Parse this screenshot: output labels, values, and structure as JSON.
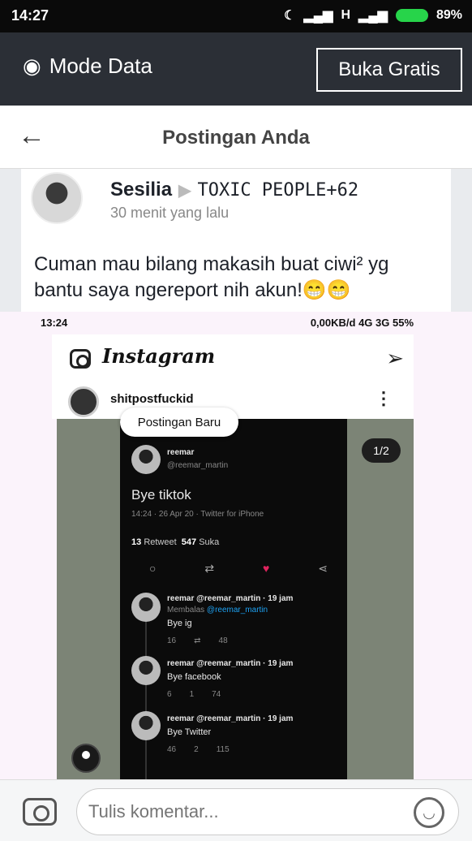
{
  "statusbar": {
    "time": "14:27",
    "network": "H",
    "battery": "89%"
  },
  "databar": {
    "mode_label": "Mode Data",
    "free_button": "Buka Gratis"
  },
  "header": {
    "title": "Postingan Anda"
  },
  "post": {
    "author": "Sesilia",
    "group": "TOXIC PEOPLE+62",
    "timeago": "30 menit yang lalu",
    "text": "Cuman mau bilang makasih buat ciwi² yg bantu saya ngereport nih akun!😁😁"
  },
  "screenshot": {
    "status_time": "13:24",
    "status_right": "0,00KB/d  4G  3G 55%",
    "app_name": "Instagram",
    "username": "shitpostfuckid",
    "new_post_pill": "Postingan Baru",
    "page_badge": "1/2",
    "tweet": {
      "name": "reemar",
      "handle": "@reemar_martin",
      "text": "Bye tiktok",
      "meta": "14:24 · 26 Apr 20 · Twitter for iPhone",
      "retweets": "13",
      "retweets_label": "Retweet",
      "likes": "547",
      "likes_label": "Suka"
    },
    "replies": [
      {
        "header": "reemar  @reemar_martin · 19 jam",
        "reply_to": "Membalas",
        "reply_handle": "@reemar_martin",
        "text": "Bye ig",
        "stats": [
          "16",
          "",
          "48"
        ]
      },
      {
        "header": "reemar  @reemar_martin · 19 jam",
        "reply_to": "",
        "reply_handle": "",
        "text": "Bye facebook",
        "stats": [
          "6",
          "1",
          "74"
        ]
      },
      {
        "header": "reemar  @reemar_martin · 19 jam",
        "reply_to": "",
        "reply_handle": "",
        "text": "Bye Twitter",
        "stats": [
          "46",
          "2",
          "115"
        ]
      }
    ]
  },
  "composer": {
    "placeholder": "Tulis komentar..."
  }
}
